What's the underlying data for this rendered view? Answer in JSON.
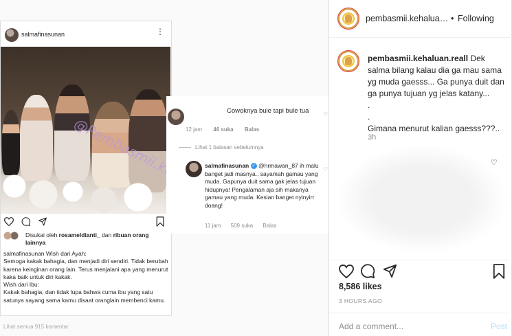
{
  "screenshot": {
    "username": "salmafinasunan",
    "watermark": "@Pembasmii.kehaluan",
    "liked_by_prefix": "Disukai oleh ",
    "liked_by_user": "rosameldianti_",
    "liked_by_suffix": " dan ",
    "liked_by_others": "ribuan orang lainnya",
    "caption": "salmafinasunan Wish dari Ayah:\nSemoga kakak bahagia, dan menjadi diri sendiri. Tidak berubah karena keinginan orang lain. Terus menjalani apa yang menurut kaka baik untuk diri kakak.\nWish dari Ibu:\nKakak bahagia, dan tidak lupa bahwa cuma ibu yang satu satunya sayang sama kamu disaat oranglain membenci kamu.",
    "more_comments": "Lihat semua 915 komentar"
  },
  "thread": {
    "comment1_text": "Cowoknya bule tapi bule tua",
    "comment1_time": "12 jam",
    "comment1_likes": "46 suka",
    "comment1_reply": "Balas",
    "view_replies": "Lihat 1 balasan sebelumnya",
    "reply_user": "salmafinasunan",
    "reply_mention": "@hrmawan_87",
    "reply_text": "ih malu banget jadi masnya.. sayamah gamau yang muda. Gapunya duit sama gak jelas tujuan hidupnya! Pengalaman aja sih makanya gamau yang muda. Kesian banget nyinyirr doang!",
    "reply_time": "11 jam",
    "reply_likes": "509 suka",
    "reply_reply": "Balas"
  },
  "panel": {
    "header_user": "pembasmii.kehaluan.real",
    "header_sep": "•",
    "header_follow": "Following",
    "caption_user": "pembasmii.kehaluan.reall",
    "caption_text": " Dek salma bilang kalau dia ga mau sama yg muda gaesss... Ga punya duit dan ga punya tujuan yg jelas katany...",
    "caption_dot1": ".",
    "caption_dot2": ".",
    "caption_question": "Gimana menurut kalian gaesss???..",
    "time": "3h",
    "likes": "8,586 likes",
    "date": "3 HOURS AGO",
    "comment_placeholder": "Add a comment...",
    "post_label": "Post"
  },
  "icons": [
    "more-icon",
    "heart-icon",
    "comment-icon",
    "share-icon",
    "bookmark-icon",
    "verified-icon"
  ]
}
